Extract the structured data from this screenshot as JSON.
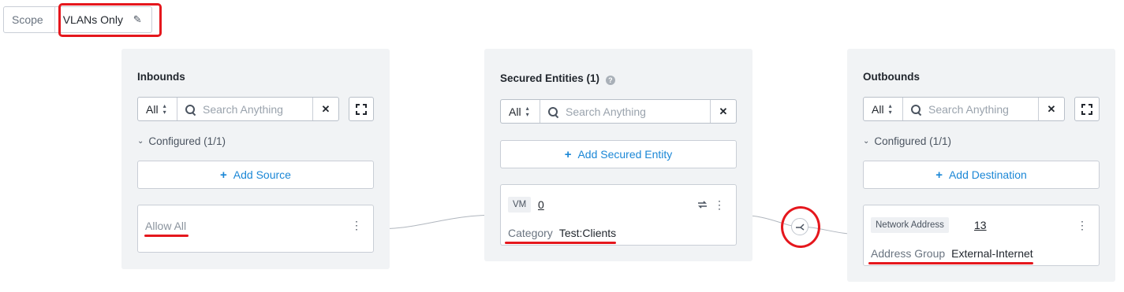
{
  "scope": {
    "label": "Scope",
    "value": "VLANs Only"
  },
  "inbounds": {
    "title": "Inbounds",
    "filter": "All",
    "search_placeholder": "Search Anything",
    "configured": "Configured (1/1)",
    "add_label": "Add Source",
    "card": {
      "label": "Allow All"
    }
  },
  "secured": {
    "title": "Secured Entities (1)",
    "filter": "All",
    "search_placeholder": "Search Anything",
    "add_label": "Add Secured Entity",
    "card": {
      "tag": "VM",
      "count": "0",
      "key": "Category",
      "value": "Test:Clients"
    }
  },
  "outbounds": {
    "title": "Outbounds",
    "filter": "All",
    "search_placeholder": "Search Anything",
    "configured": "Configured (1/1)",
    "add_label": "Add Destination",
    "card": {
      "tag": "Network Address",
      "count": "13",
      "key": "Address Group",
      "value": "External-Internet"
    }
  },
  "colors": {
    "accent": "#1b87d6",
    "annotation": "#e5171d",
    "panel_bg": "#f1f3f5"
  }
}
